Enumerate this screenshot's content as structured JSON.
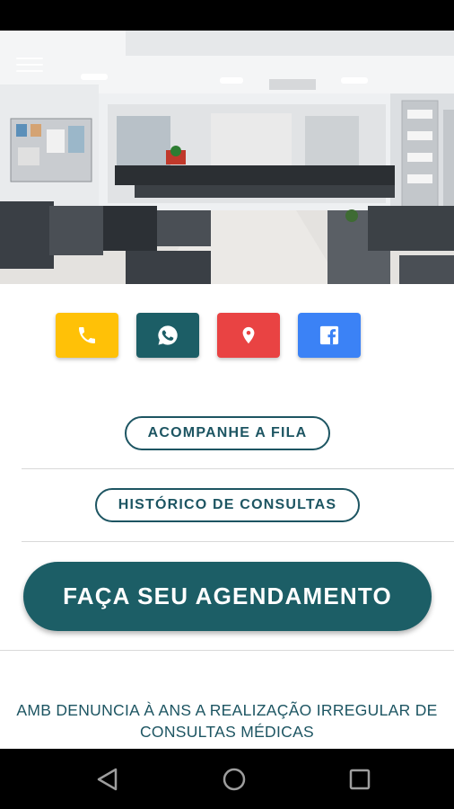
{
  "hero": {
    "image": "clinic-reception-photo"
  },
  "contacts": [
    {
      "name": "phone",
      "icon": "phone-icon",
      "color": "#FFC107"
    },
    {
      "name": "whatsapp",
      "icon": "whatsapp-icon",
      "color": "#1C5E66"
    },
    {
      "name": "location",
      "icon": "location-pin-icon",
      "color": "#E94343"
    },
    {
      "name": "facebook",
      "icon": "facebook-icon",
      "color": "#3B82F6"
    }
  ],
  "buttons": {
    "queue": "ACOMPANHE A FILA",
    "history": "HISTÓRICO DE CONSULTAS",
    "schedule": "FAÇA SEU AGENDAMENTO"
  },
  "news": {
    "headline": "AMB DENUNCIA À ANS A REALIZAÇÃO IRREGULAR DE CONSULTAS MÉDICAS"
  },
  "colors": {
    "primary": "#1C5E66",
    "text": "#1D5562"
  }
}
